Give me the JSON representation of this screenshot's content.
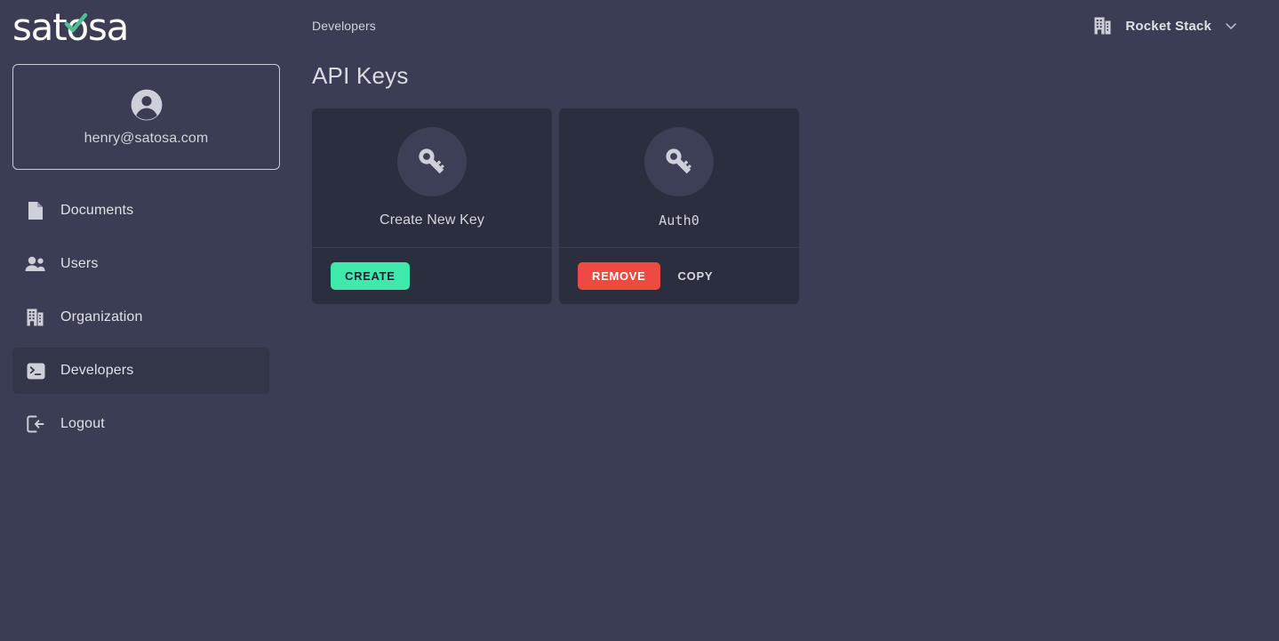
{
  "brand": {
    "logo_text": "satosa",
    "logo_check_color": "#4cbf94",
    "accent_green": "#3fe8ab",
    "accent_red": "#ee4a42"
  },
  "sidebar": {
    "user": {
      "avatar_icon": "account-circle-icon",
      "email": "henry@satosa.com"
    },
    "items": [
      {
        "label": "Documents",
        "icon": "document-icon",
        "active": false
      },
      {
        "label": "Users",
        "icon": "users-icon",
        "active": false
      },
      {
        "label": "Organization",
        "icon": "building-icon",
        "active": false
      },
      {
        "label": "Developers",
        "icon": "terminal-icon",
        "active": true
      },
      {
        "label": "Logout",
        "icon": "logout-icon",
        "active": false
      }
    ]
  },
  "topbar": {
    "breadcrumb": "Developers",
    "org": {
      "icon": "building-icon",
      "name": "Rocket Stack",
      "chevron": "chevron-down-icon"
    }
  },
  "main": {
    "page_title": "API Keys",
    "cards": [
      {
        "icon": "key-icon",
        "label": "Create New Key",
        "label_mono": false,
        "actions": [
          {
            "label": "CREATE",
            "style": "create"
          }
        ]
      },
      {
        "icon": "key-icon",
        "label": "Auth0",
        "label_mono": true,
        "actions": [
          {
            "label": "REMOVE",
            "style": "remove"
          },
          {
            "label": "COPY",
            "style": "copy"
          }
        ]
      }
    ]
  }
}
